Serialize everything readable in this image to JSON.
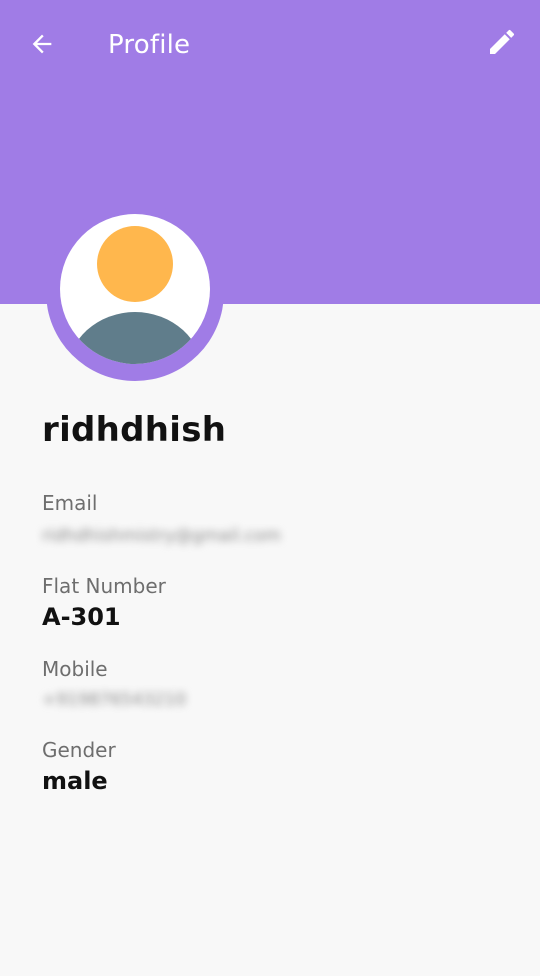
{
  "app": {
    "title": "Profile",
    "header_color": "#a07ce6"
  },
  "toolbar": {
    "back_icon": "arrow-left-icon",
    "edit_icon": "pencil-icon"
  },
  "avatar": {
    "icon": "user-avatar-icon",
    "head_color": "#ffb74d",
    "body_color": "#607d8b"
  },
  "profile": {
    "name": "ridhdhish",
    "fields": [
      {
        "label": "Email",
        "value": "ridhdhishmistry@gmail.com"
      },
      {
        "label": "Flat Number",
        "value": "A-301"
      },
      {
        "label": "Mobile",
        "value": "+919876543210"
      },
      {
        "label": "Gender",
        "value": "male"
      }
    ]
  }
}
